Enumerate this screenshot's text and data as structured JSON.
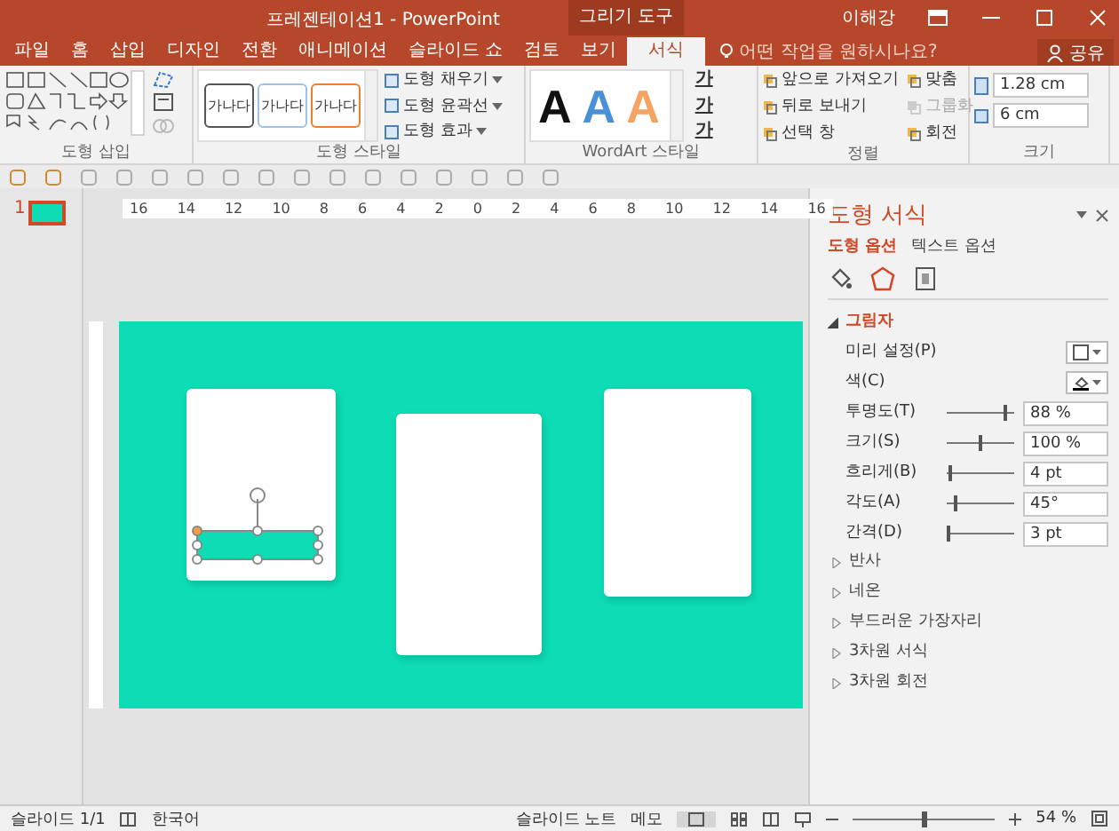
{
  "window": {
    "title": "프레젠테이션1 - PowerPoint",
    "context_group": "그리기 도구",
    "user": "이해강"
  },
  "tabs": [
    {
      "label": "파일",
      "selected": false
    },
    {
      "label": "홈",
      "selected": false
    },
    {
      "label": "삽입",
      "selected": false
    },
    {
      "label": "디자인",
      "selected": false
    },
    {
      "label": "전환",
      "selected": false
    },
    {
      "label": "애니메이션",
      "selected": false
    },
    {
      "label": "슬라이드 쇼",
      "selected": false
    },
    {
      "label": "검토",
      "selected": false
    },
    {
      "label": "보기",
      "selected": false
    },
    {
      "label": "서식",
      "selected": true
    }
  ],
  "tell_me": {
    "placeholder": "어떤 작업을 원하시나요?"
  },
  "share": "공유",
  "ribbon": {
    "insert_shapes": {
      "label": "도형 삽입"
    },
    "shape_styles": {
      "label": "도형 스타일",
      "presets": [
        {
          "text": "가나다",
          "color": "#555555"
        },
        {
          "text": "가나다",
          "color": "#9dc3e6"
        },
        {
          "text": "가나다",
          "color": "#ed7d31"
        }
      ],
      "commands": [
        "도형 채우기",
        "도형 윤곽선",
        "도형 효과"
      ]
    },
    "wordart_styles": {
      "label": "WordArt 스타일",
      "presets": [
        {
          "text": "A",
          "color": "#111111"
        },
        {
          "text": "A",
          "color": "#4a90d9"
        },
        {
          "text": "A",
          "color": "#f4a460"
        }
      ],
      "text_buttons": [
        "가",
        "가",
        "가"
      ]
    },
    "arrange": {
      "label": "정렬",
      "commands": [
        {
          "label": "앞으로 가져오기",
          "disabled": false
        },
        {
          "label": "뒤로 보내기",
          "disabled": false
        },
        {
          "label": "선택 창",
          "disabled": false
        },
        {
          "label": "맞춤",
          "disabled": false
        },
        {
          "label": "그룹화",
          "disabled": true
        },
        {
          "label": "회전",
          "disabled": false
        }
      ]
    },
    "size": {
      "label": "크기",
      "height": "1.28 cm",
      "width": "6 cm"
    }
  },
  "ruler_labels": [
    "16",
    "14",
    "12",
    "10",
    "8",
    "6",
    "4",
    "2",
    "0",
    "2",
    "4",
    "6",
    "8",
    "10",
    "12",
    "14",
    "16"
  ],
  "slide_pane": {
    "number": "1"
  },
  "format_pane": {
    "title": "도형 서식",
    "tabs": [
      {
        "label": "도형 옵션",
        "selected": true
      },
      {
        "label": "텍스트 옵션",
        "selected": false
      }
    ],
    "section": {
      "label": "그림자",
      "expanded": true,
      "rows": [
        {
          "kind": "picker",
          "label": "미리 설정(P)"
        },
        {
          "kind": "color",
          "label": "색(C)"
        },
        {
          "kind": "slider",
          "label": "투명도(T)",
          "level": 0.88,
          "value": "88 %"
        },
        {
          "kind": "slider",
          "label": "크기(S)",
          "level": 0.5,
          "value": "100 %"
        },
        {
          "kind": "slider",
          "label": "흐리게(B)",
          "level": 0.04,
          "value": "4 pt"
        },
        {
          "kind": "slider",
          "label": "각도(A)",
          "level": 0.125,
          "value": "45°"
        },
        {
          "kind": "slider",
          "label": "간격(D)",
          "level": 0.03,
          "value": "3 pt"
        }
      ]
    },
    "collapsed_sections": [
      {
        "label": "반사",
        "expanded": false
      },
      {
        "label": "네온",
        "expanded": false
      },
      {
        "label": "부드러운 가장자리",
        "expanded": false
      },
      {
        "label": "3차원 서식",
        "expanded": false
      },
      {
        "label": "3차원 회전",
        "expanded": false
      }
    ]
  },
  "status_bar": {
    "slide": "슬라이드 1/1",
    "language": "한국어",
    "notes": "슬라이드 노트",
    "comments": "메모",
    "zoom": "54 %",
    "zoom_slider": {
      "level": 0.5
    }
  }
}
